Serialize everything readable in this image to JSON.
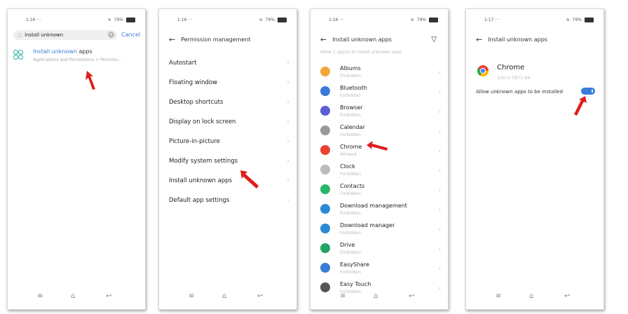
{
  "phone1": {
    "time": "1:16 ···",
    "battery": "79%",
    "search_value": "install unknown",
    "cancel_label": "Cancel",
    "result_title_highlight": "Install unknown",
    "result_title_rest": " apps",
    "result_path": "Applications and Permissions > Permissi..."
  },
  "phone2": {
    "time": "1:16 ···",
    "battery": "79%",
    "title": "Permission management",
    "items": [
      "Autostart",
      "Floating window",
      "Desktop shortcuts",
      "Display on lock screen",
      "Picture-in-picture",
      "Modify system settings",
      "Install unknown apps",
      "Default app settings"
    ]
  },
  "phone3": {
    "time": "1:16 ···",
    "battery": "79%",
    "title": "Install unknown apps",
    "subheader": "Allow 1 app(s) to install unknown apps",
    "apps": [
      {
        "name": "Albums",
        "status": "Forbidden",
        "color": "#f3a73b"
      },
      {
        "name": "Bluetooth",
        "status": "Forbidden",
        "color": "#3a7bd5"
      },
      {
        "name": "Browser",
        "status": "Forbidden",
        "color": "#5a5fd3"
      },
      {
        "name": "Calendar",
        "status": "Forbidden",
        "color": "#999999"
      },
      {
        "name": "Chrome",
        "status": "Allowed",
        "color": "#e94235"
      },
      {
        "name": "Clock",
        "status": "Forbidden",
        "color": "#bbbbbb"
      },
      {
        "name": "Contacts",
        "status": "Forbidden",
        "color": "#2ab56a"
      },
      {
        "name": "Download management",
        "status": "Forbidden",
        "color": "#2a8ad5"
      },
      {
        "name": "Download manager",
        "status": "Forbidden",
        "color": "#2a8ad5"
      },
      {
        "name": "Drive",
        "status": "Forbidden",
        "color": "#1fa463"
      },
      {
        "name": "EasyShare",
        "status": "Forbidden",
        "color": "#3a7bd5"
      },
      {
        "name": "Easy Touch",
        "status": "Forbidden",
        "color": "#555555"
      }
    ]
  },
  "phone4": {
    "time": "1:17 ···",
    "battery": "79%",
    "title": "Install unknown apps",
    "app_name": "Chrome",
    "app_version": "150.0.7871.84",
    "toggle_label": "Allow unknown apps to be installed",
    "toggle_on": true
  },
  "nav": {
    "menu": "≡",
    "home": "⌂",
    "back": "↩"
  }
}
